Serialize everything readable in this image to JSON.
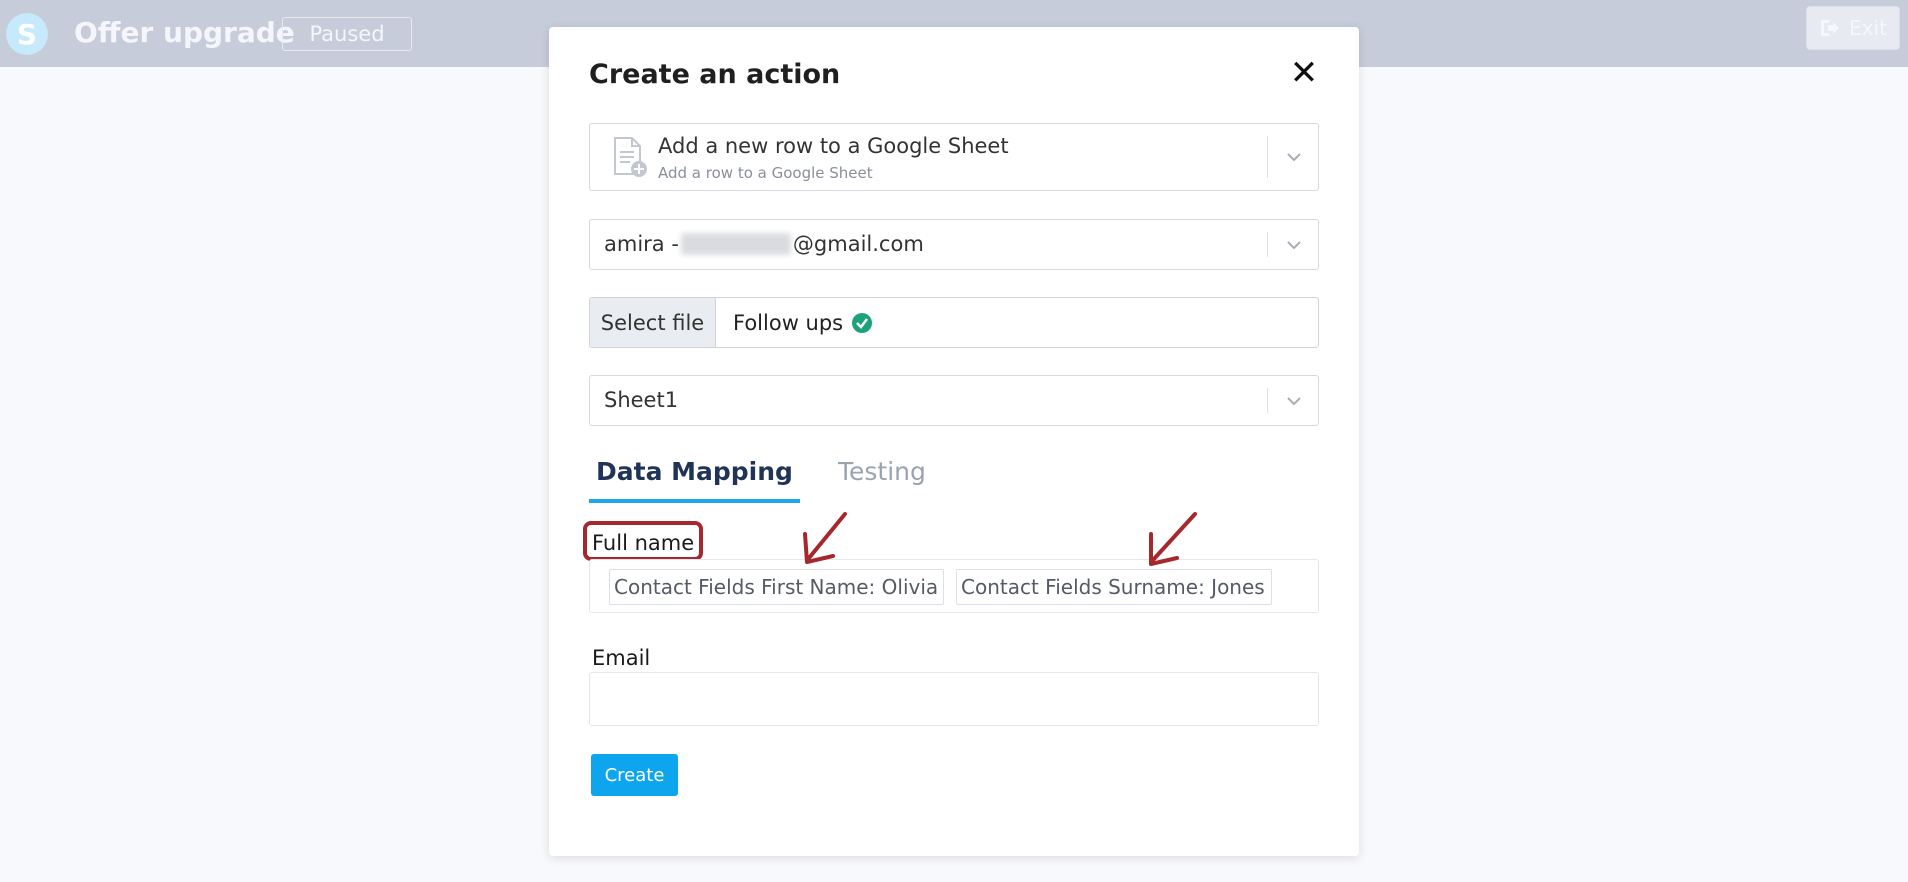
{
  "header": {
    "logo_letter": "S",
    "title": "Offer upgrade",
    "status": "Paused",
    "exit_label": "Exit",
    "exit_icon": "sign-out-icon"
  },
  "modal": {
    "title": "Create an action",
    "close_icon": "close-icon",
    "close_glyph": "✕",
    "action_select": {
      "icon": "google-sheet-add-icon",
      "label": "Add a new row to a Google Sheet",
      "description": "Add a row to a Google Sheet"
    },
    "account_select": {
      "prefix": "amira -",
      "suffix": "@gmail.com"
    },
    "file": {
      "button_label": "Select file",
      "file_name": "Follow ups",
      "status_icon": "check-circle-icon",
      "status_color": "#1aa37a"
    },
    "sheet_select": {
      "value": "Sheet1"
    },
    "tabs": [
      {
        "label": "Data Mapping",
        "active": true
      },
      {
        "label": "Testing",
        "active": false
      }
    ],
    "fields": {
      "full_name": {
        "label": "Full name",
        "chips": [
          "Contact Fields First Name: Olivia",
          "Contact Fields Surname: Jones"
        ]
      },
      "email": {
        "label": "Email",
        "value": ""
      }
    },
    "create_label": "Create"
  },
  "annotations": {
    "highlight_color": "#a5282d",
    "arrow_color": "#a5282d"
  },
  "colors": {
    "accent": "#0ea5ef",
    "tab_active": "#1f3456",
    "tab_inactive": "#9aa3b0"
  }
}
